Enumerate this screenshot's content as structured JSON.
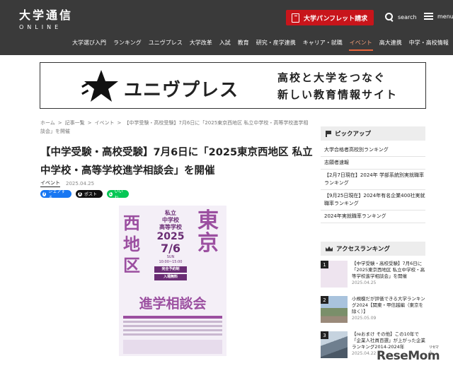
{
  "header": {
    "logo_main": "大学通信",
    "logo_sub": "ONLINE",
    "pamphlet_label": "大学パンフレット請求",
    "search_label": "search",
    "menu_label": "menu"
  },
  "nav": {
    "items": [
      "大学選び入門",
      "ランキング",
      "ユニヴプレス",
      "大学改革",
      "入試",
      "教育",
      "研究・産学連携",
      "キャリア・就職",
      "イベント",
      "高大連携",
      "中学・高校情報",
      "動画"
    ],
    "active_index": 8
  },
  "banner": {
    "brand": "ユニヴプレス",
    "tagline_1": "高校と大学をつなぐ",
    "tagline_2": "新しい教育情報サイト"
  },
  "breadcrumb": {
    "items": [
      "ホーム",
      "記事一覧",
      "イベント",
      "【中学受験・高校受験】7月6日に「2025東京西地区 私立中学校・高等学校進学相談会」を開催"
    ]
  },
  "article": {
    "title": "【中学受験・高校受験】7月6日に「2025東京西地区 私立中学校・高等学校進学相談会」を開催",
    "category": "イベント",
    "date": "2025.04.25"
  },
  "share": {
    "facebook": "シェアする",
    "x": "ポスト",
    "line": "いいね"
  },
  "poster": {
    "left_text": "西地区",
    "right_text": "東京",
    "school_1": "私立",
    "school_2": "中学校",
    "school_3": "高等学校",
    "year": "2025",
    "date": "7/6",
    "weekday": "SUN",
    "time": "10:00~15:00",
    "reserve": "完全予約制",
    "free": "入場無料",
    "bottom_text": "進学相談会"
  },
  "pickup": {
    "heading": "ピックアップ",
    "items": [
      "大学合格者高校別ランキング",
      "志願者速報",
      "【2月7日現在】2024年 学部系統別実就職率ランキング",
      "【9月25日現在】2024年有名企業400社実就職率ランキング",
      "2024年実就職率ランキング"
    ]
  },
  "ranking": {
    "heading": "アクセスランキング",
    "items": [
      {
        "rank": "1",
        "text": "【中学受験・高校受験】7月6日に「2025東京西地区 私立中学校・高等学校進学相談会」を開催",
        "date": "2025.04.25"
      },
      {
        "rank": "2",
        "text": "小規模だが評価できる大学ランキング2024【関東・甲信越編（東京を除く）】",
        "date": "2025.05.09"
      },
      {
        "rank": "3",
        "text": "【reおまけ その他】この10年で「企業人社員百選」が上がった企業ランキング2014-2024年",
        "date": "2025.04.22"
      }
    ]
  },
  "watermark": {
    "text": "ReseMom",
    "small": "リセマム"
  },
  "colors": {
    "header_bg": "#3a3a3a",
    "accent_red": "#c8151b",
    "nav_active": "#e8643a",
    "poster_purple": "#9b4fa0"
  }
}
